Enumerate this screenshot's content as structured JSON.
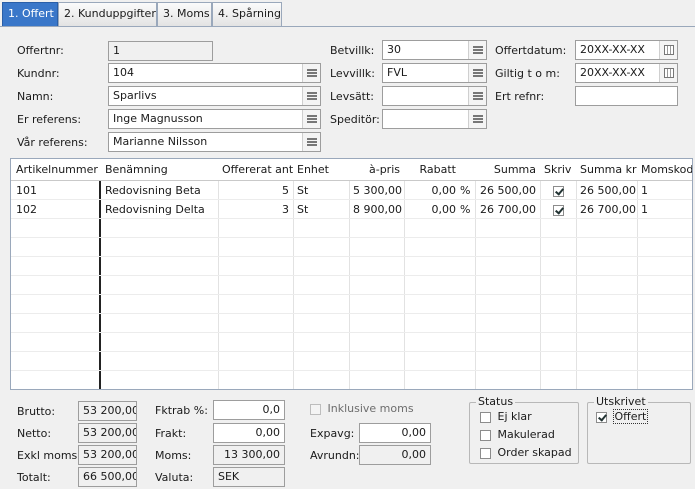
{
  "tabs": [
    "1. Offert",
    "2. Kunduppgifter",
    "3. Moms",
    "4. Spårning"
  ],
  "header": {
    "offertnr": {
      "label": "Offertnr:",
      "value": "1"
    },
    "kundnr": {
      "label": "Kundnr:",
      "value": "104"
    },
    "namn": {
      "label": "Namn:",
      "value": "Sparlivs"
    },
    "er_referens": {
      "label": "Er referens:",
      "value": "Inge Magnusson"
    },
    "var_referens": {
      "label": "Vår referens:",
      "value": "Marianne Nilsson"
    },
    "betvillk": {
      "label": "Betvillk:",
      "value": "30"
    },
    "levvillk": {
      "label": "Levvillk:",
      "value": "FVL"
    },
    "levsatt": {
      "label": "Levsätt:",
      "value": ""
    },
    "speditor": {
      "label": "Speditör:",
      "value": ""
    },
    "offertdatum": {
      "label": "Offertdatum:",
      "value": "20XX-XX-XX"
    },
    "giltig_tom": {
      "label": "Giltig t o m:",
      "value": "20XX-XX-XX"
    },
    "ert_refnr": {
      "label": "Ert refnr:",
      "value": ""
    }
  },
  "grid": {
    "columns": [
      "Artikelnummer",
      "Benämning",
      "Offererat antal",
      "Enhet",
      "à-pris",
      "Rabatt",
      "Summa",
      "Skriv",
      "Summa kr",
      "Momskod"
    ],
    "rows": [
      {
        "artikelnummer": "101",
        "benamning": "Redovisning Beta",
        "antal": "5",
        "enhet": "St",
        "apris": "5 300,00",
        "rabatt": "0,00",
        "rabatt_unit": "%",
        "summa": "26 500,00",
        "skriv": true,
        "summa_kr": "26 500,00",
        "momskod": "1"
      },
      {
        "artikelnummer": "102",
        "benamning": "Redovisning Delta",
        "antal": "3",
        "enhet": "St",
        "apris": "8 900,00",
        "rabatt": "0,00",
        "rabatt_unit": "%",
        "summa": "26 700,00",
        "skriv": true,
        "summa_kr": "26 700,00",
        "momskod": "1"
      }
    ]
  },
  "totals": {
    "brutto": {
      "label": "Brutto:",
      "value": "53 200,00"
    },
    "netto": {
      "label": "Netto:",
      "value": "53 200,00"
    },
    "exkl_moms": {
      "label": "Exkl moms:",
      "value": "53 200,00"
    },
    "totalt": {
      "label": "Totalt:",
      "value": "66 500,00"
    },
    "fktrab": {
      "label": "Fktrab %:",
      "value": "0,0"
    },
    "frakt": {
      "label": "Frakt:",
      "value": "0,00"
    },
    "moms": {
      "label": "Moms:",
      "value": "13 300,00"
    },
    "valuta": {
      "label": "Valuta:",
      "value": "SEK"
    },
    "inklusive_moms": {
      "label": "Inklusive moms",
      "checked": false
    },
    "expavg": {
      "label": "Expavg:",
      "value": "0,00"
    },
    "avrundn": {
      "label": "Avrundn:",
      "value": "0,00"
    }
  },
  "status": {
    "title": "Status",
    "ej_klar": {
      "label": "Ej klar",
      "checked": false
    },
    "makulerad": {
      "label": "Makulerad",
      "checked": false
    },
    "order_skapad": {
      "label": "Order skapad",
      "checked": false
    }
  },
  "utskrivet": {
    "title": "Utskrivet",
    "offert": {
      "label": "Offert",
      "checked": true
    }
  },
  "icons": {
    "lookup": "list-lookup-icon",
    "calendar": "calendar-icon"
  }
}
